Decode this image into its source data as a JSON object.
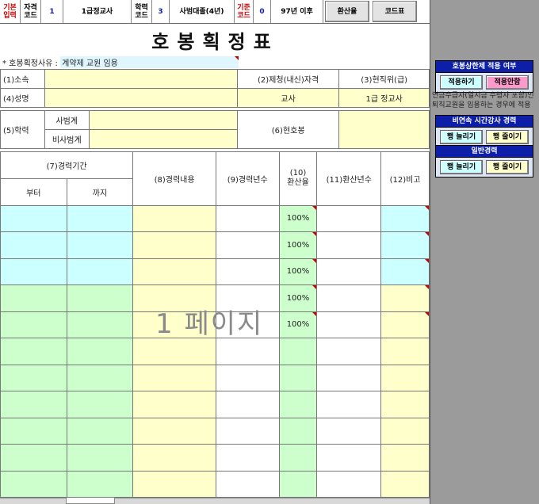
{
  "topbar": {
    "basic_input": "기본\n입력",
    "qual_code_label": "자격\n코드",
    "qual_code": "1",
    "qual_name": "1급정교사",
    "edu_code_label": "학력\n코드",
    "edu_code": "3",
    "edu_name": "사범대졸(4년)",
    "std_code_label": "기준\n코드",
    "std_code": "0",
    "std_name": "97년 이후",
    "convert_btn": "환산율",
    "code_btn": "코드표"
  },
  "title": "호봉획정표",
  "reason": {
    "label": "* 호봉획정사유 :",
    "value": "계약제 교원 임용"
  },
  "form": {
    "affiliation": "(1)소속",
    "qualification": "(2)제청(내신)자격",
    "position": "(3)현직위(급)",
    "name": "(4)성명",
    "qual_value": "교사",
    "position_value": "1급 정교사",
    "education": "(5)학력",
    "teachers_college": "사범계",
    "non_teachers_college": "비사범계",
    "current_step": "(6)현호봉"
  },
  "table": {
    "period": "(7)경력기간",
    "from": "부터",
    "to": "까지",
    "content": "(8)경력내용",
    "years": "(9)경력년수",
    "rate": "(10)\n환산율",
    "converted": "(11)환산년수",
    "remarks": "(12)비고",
    "rates": [
      "100%",
      "100%",
      "100%",
      "100%",
      "100%",
      "",
      "",
      "",
      "",
      "",
      ""
    ]
  },
  "watermark": "1 페이지",
  "side": {
    "limit_title": "호봉상한제 적용 여부",
    "apply_btn": "적용하기",
    "not_apply_btn": "적용안함",
    "note1": "연금수급자(일시금 수령자 포함)인",
    "note2": "퇴직교원을 임용하는 경우에 적용",
    "lecturer_title": "비연속 시간강사 경력",
    "general_title": "일반경력",
    "add_row": "행 늘리기",
    "remove_row": "행 줄이기"
  },
  "colors": {
    "sky": "#ccffff",
    "mint": "#ccffcc",
    "cream": "#ffffcc",
    "panel_header": "#0d1fa8"
  }
}
